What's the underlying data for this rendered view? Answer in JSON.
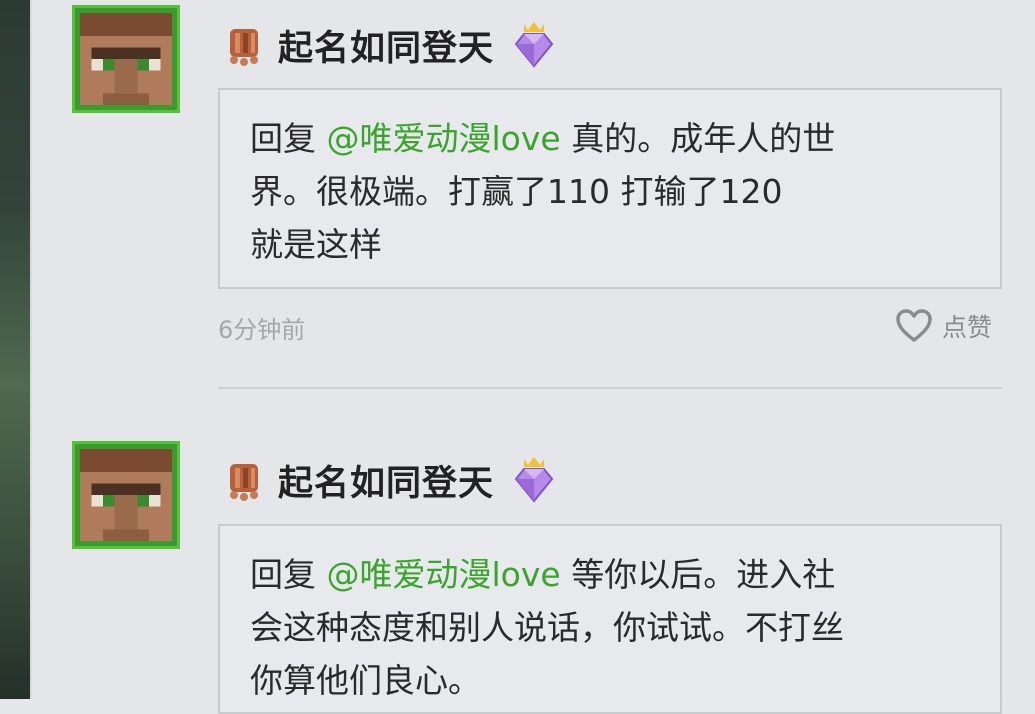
{
  "comments": [
    {
      "username": "起名如同登天",
      "reply_prefix": "回复 ",
      "mention": "@唯爱动漫love",
      "text_lines": [
        "真的。成年人的世",
        "界。很极端。打赢了110 打输了120",
        "就是这样"
      ],
      "time": "6分钟前",
      "like_label": "点赞"
    },
    {
      "username": "起名如同登天",
      "reply_prefix": "回复 ",
      "mention": "@唯爱动漫love",
      "text_lines": [
        "等你以后。进入社",
        "会这种态度和别人说话，你试试。不打丝",
        "你算他们良心。"
      ]
    }
  ],
  "colors": {
    "accent_green": "#3aa52d",
    "avatar_border": "#55c23a",
    "vip_purple": "#b58ae8"
  },
  "icons": [
    "villager-avatar-icon",
    "copper-badge-icon",
    "vip-diamond-icon",
    "heart-icon"
  ]
}
